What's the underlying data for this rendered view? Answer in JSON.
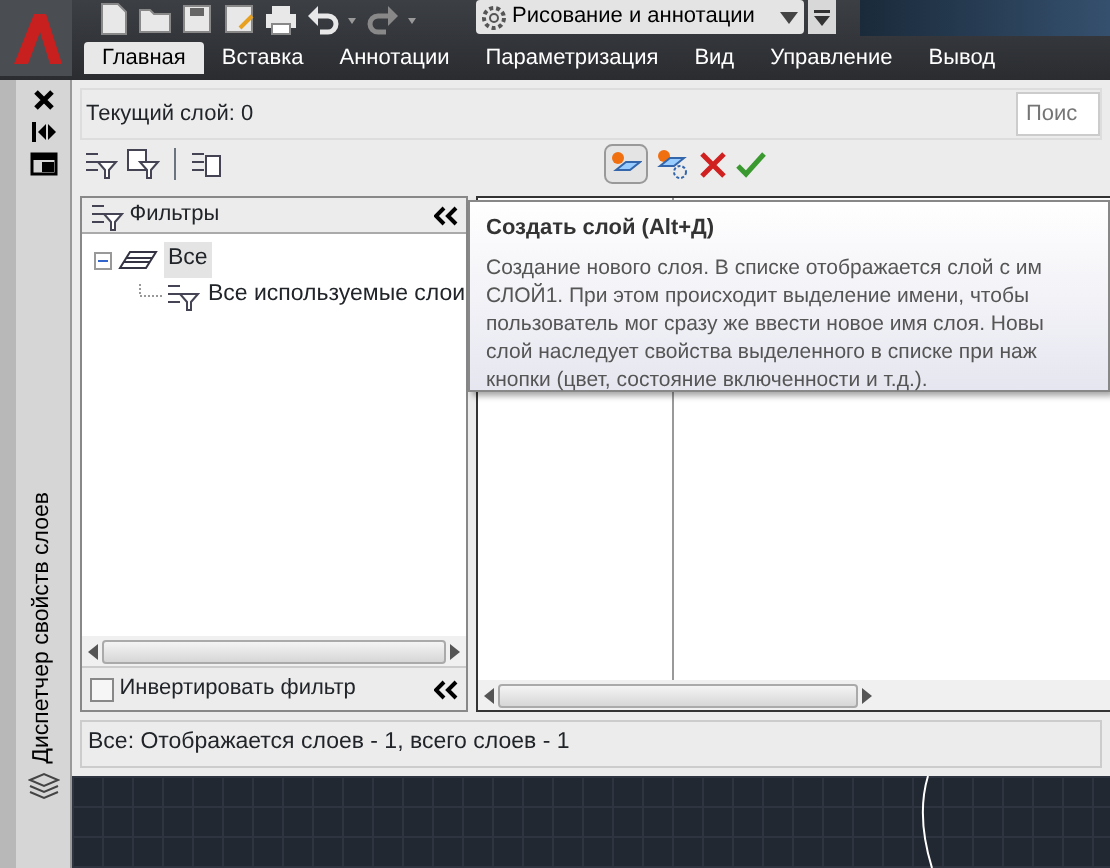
{
  "app": {
    "workspace": "Рисование и аннотации"
  },
  "ribbon_tabs": [
    {
      "label": "Главная",
      "selected": true
    },
    {
      "label": "Вставка",
      "selected": false
    },
    {
      "label": "Аннотации",
      "selected": false
    },
    {
      "label": "Параметризация",
      "selected": false
    },
    {
      "label": "Вид",
      "selected": false
    },
    {
      "label": "Управление",
      "selected": false
    },
    {
      "label": "Вывод",
      "selected": false
    }
  ],
  "palette": {
    "title": "Диспетчер свойств слоев",
    "current_layer": "Текущий слой: 0",
    "search": {
      "placeholder": "Поис"
    },
    "filters": {
      "header": "Фильтры",
      "tree": [
        {
          "label": "Все",
          "expanded": true,
          "selected": true,
          "children": [
            {
              "label": "Все используемые слои"
            }
          ]
        }
      ],
      "invert": {
        "label": "Инвертировать фильтр",
        "checked": false
      }
    },
    "tooltip": {
      "title": "Создать слой (Alt+Д)",
      "lines": [
        "Создание нового слоя. В списке отображается слой с им",
        "СЛОЙ1. При этом происходит выделение имени, чтобы",
        "пользователь мог сразу же ввести новое имя слоя. Новы",
        "слой наследует свойства выделенного в списке при наж",
        "кнопки (цвет, состояние включенности и т.д.)."
      ]
    },
    "status": "Все: Отображается слоев - 1, всего слоев - 1"
  }
}
